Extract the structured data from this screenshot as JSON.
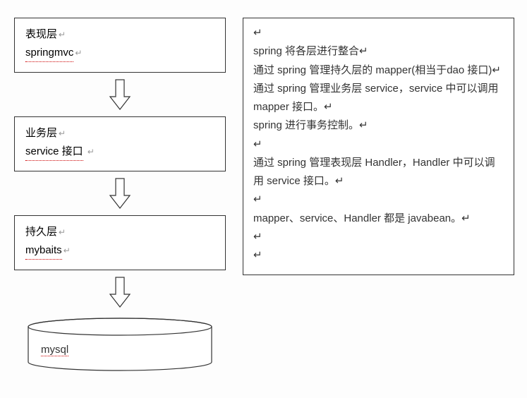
{
  "layers": [
    {
      "title": "表现层",
      "tech": "springmvc"
    },
    {
      "title": "业务层",
      "tech": "service 接口"
    },
    {
      "title": "持久层",
      "tech": "mybaits"
    }
  ],
  "database": {
    "label": "mysql"
  },
  "return_mark": "↵",
  "description": {
    "lines": [
      "↵",
      "spring 将各层进行整合↵",
      "通过 spring 管理持久层的 mapper(相当于dao 接口)↵",
      "通过 spring 管理业务层 service，service 中可以调用 mapper 接口。↵",
      "spring 进行事务控制。↵",
      "↵",
      "通过 spring 管理表现层 Handler，Handler 中可以调用 service 接口。↵",
      "↵",
      "mapper、service、Handler 都是 javabean。↵",
      "↵",
      "↵"
    ]
  }
}
